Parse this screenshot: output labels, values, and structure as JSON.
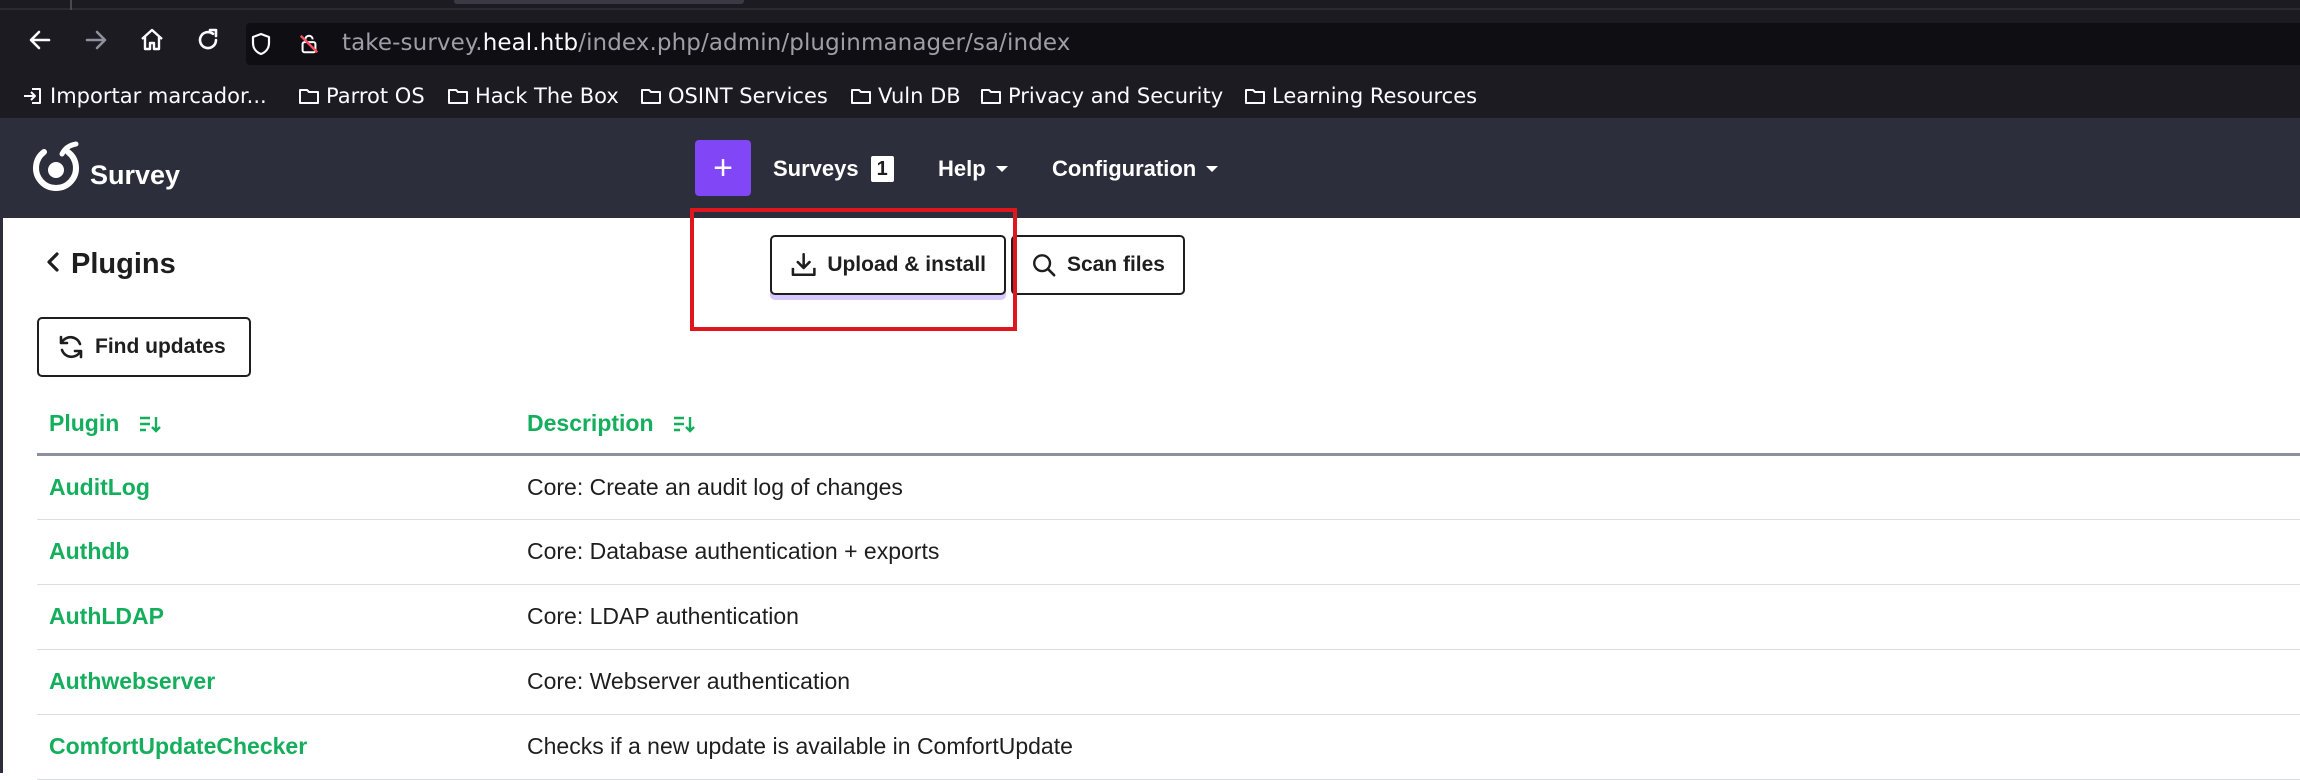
{
  "browser": {
    "url_prefix": "take-survey.",
    "url_domain": "heal.htb",
    "url_path": "/index.php/admin/pluginmanager/sa/index",
    "bookmarks": [
      {
        "label": "Importar marcador...",
        "icon": "import-icon"
      },
      {
        "label": "Parrot OS",
        "icon": "folder-icon"
      },
      {
        "label": "Hack The Box",
        "icon": "folder-icon"
      },
      {
        "label": "OSINT Services",
        "icon": "folder-icon"
      },
      {
        "label": "Vuln DB",
        "icon": "folder-icon"
      },
      {
        "label": "Privacy and Security",
        "icon": "folder-icon"
      },
      {
        "label": "Learning Resources",
        "icon": "folder-icon"
      }
    ]
  },
  "app": {
    "brand": "Survey",
    "plus_label": "+",
    "menu": {
      "surveys": "Surveys",
      "surveys_count": "1",
      "help": "Help",
      "configuration": "Configuration"
    },
    "colors": {
      "header_bg": "#2c2e3c",
      "accent": "#8146f6",
      "link_green": "#14ae5c",
      "highlight": "#e0161e"
    }
  },
  "page": {
    "title": "Plugins",
    "buttons": {
      "upload": "Upload & install",
      "scan": "Scan files",
      "find_updates": "Find updates"
    },
    "table": {
      "headers": [
        "Plugin",
        "Description"
      ],
      "rows": [
        {
          "name": "AuditLog",
          "description": "Core: Create an audit log of changes"
        },
        {
          "name": "Authdb",
          "description": "Core: Database authentication + exports"
        },
        {
          "name": "AuthLDAP",
          "description": "Core: LDAP authentication"
        },
        {
          "name": "Authwebserver",
          "description": "Core: Webserver authentication"
        },
        {
          "name": "ComfortUpdateChecker",
          "description": "Checks if a new update is available in ComfortUpdate"
        }
      ]
    }
  }
}
